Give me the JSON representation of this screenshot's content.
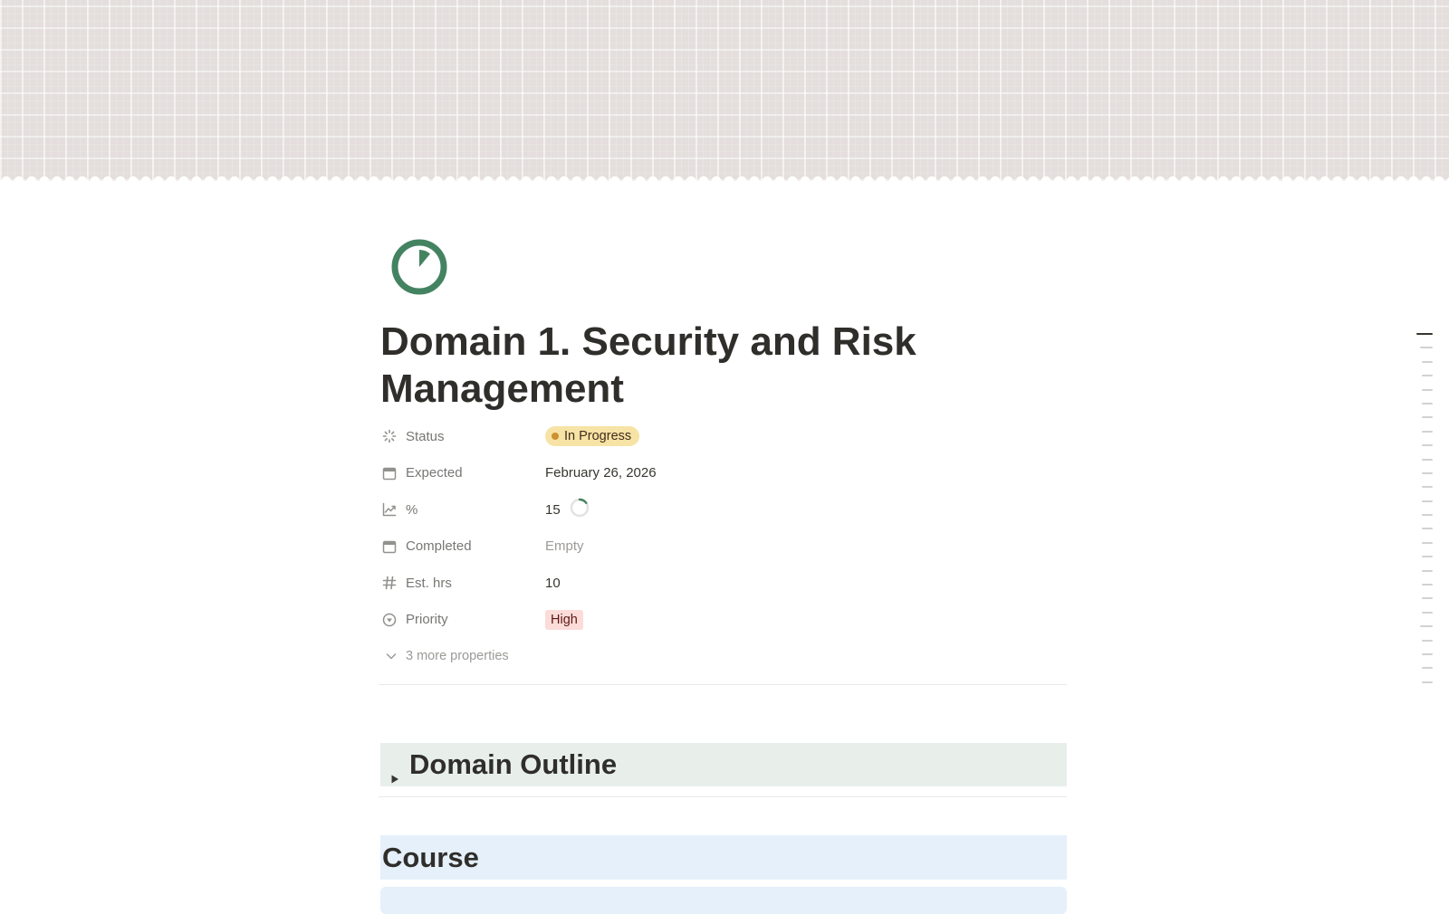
{
  "page": {
    "title": "Domain 1. Security and Risk Management",
    "icon": "progress-circle-icon",
    "icon_color": "#448361"
  },
  "properties": [
    {
      "name": "Status",
      "icon": "status-loader-icon",
      "value": "In Progress",
      "type": "status",
      "color": "#f6e3a5"
    },
    {
      "name": "Expected",
      "icon": "calendar-icon",
      "value": "February 26, 2026",
      "type": "date"
    },
    {
      "name": "%",
      "icon": "chart-line-icon",
      "value": "15",
      "type": "number",
      "progress": 0.15
    },
    {
      "name": "Completed",
      "icon": "calendar-icon",
      "value": "Empty",
      "type": "date"
    },
    {
      "name": "Est. hrs",
      "icon": "hash-icon",
      "value": "10",
      "type": "number"
    },
    {
      "name": "Priority",
      "icon": "select-arrow-icon",
      "value": "High",
      "type": "select",
      "color": "#fbdcd8"
    }
  ],
  "more_properties_label": "3 more properties",
  "sections": {
    "toggle_heading": "Domain Outline",
    "course_heading": "Course"
  },
  "colors": {
    "accent_green": "#448361",
    "toggle_bg": "#e8efea",
    "course_bg": "#e5f0fa",
    "cover_bg": "#e4dedc"
  }
}
